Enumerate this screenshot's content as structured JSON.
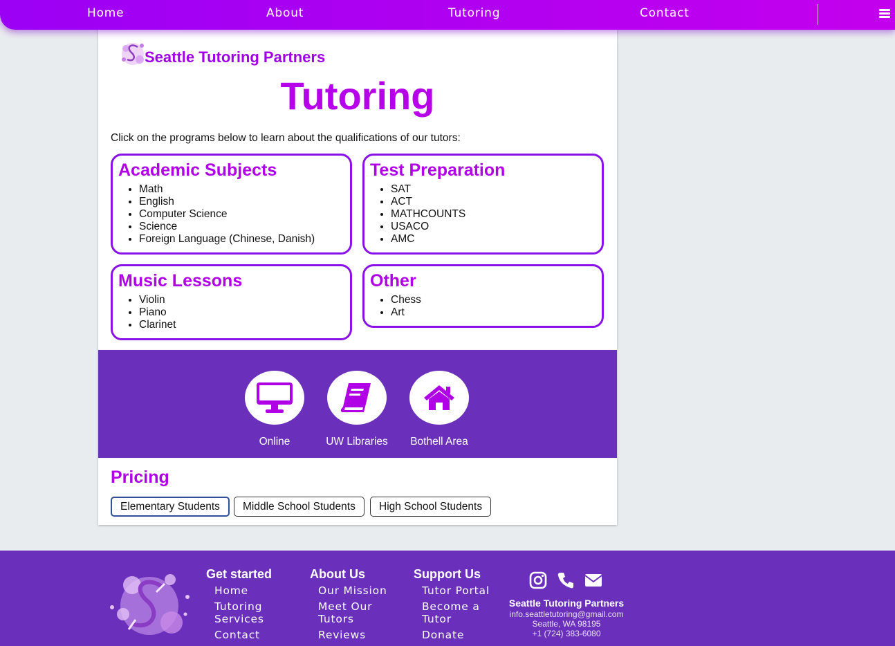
{
  "nav": {
    "links": [
      "Home",
      "About",
      "Tutoring",
      "Contact"
    ],
    "menu_icon": "hamburger-icon",
    "gradient": [
      "#9b00f5",
      "#c300ee"
    ]
  },
  "brand": {
    "name": "Seattle Tutoring Partners",
    "logo_icon": "brand-s-logo",
    "color": "#a100e6"
  },
  "page": {
    "title": "Tutoring",
    "intro": "Click on the programs below to learn about the qualifications of our tutors:"
  },
  "programs": [
    {
      "title": "Academic Subjects",
      "items": [
        "Math",
        "English",
        "Computer Science",
        "Science",
        "Foreign Language (Chinese, Danish)"
      ]
    },
    {
      "title": "Test Preparation",
      "items": [
        "SAT",
        "ACT",
        "MATHCOUNTS",
        "USACO",
        "AMC"
      ]
    },
    {
      "title": "Music Lessons",
      "items": [
        "Violin",
        "Piano",
        "Clarinet"
      ]
    },
    {
      "title": "Other",
      "items": [
        "Chess",
        "Art"
      ]
    }
  ],
  "locations": [
    {
      "label": "Online",
      "icon": "desktop-icon"
    },
    {
      "label": "UW Libraries",
      "icon": "book-icon"
    },
    {
      "label": "Bothell Area",
      "icon": "home-icon"
    }
  ],
  "pricing": {
    "title": "Pricing",
    "tabs": [
      "Elementary Students",
      "Middle School Students",
      "High School Students"
    ],
    "selected": "Elementary Students"
  },
  "footer": {
    "columns": [
      {
        "heading": "Get started",
        "links": [
          "Home",
          "Tutoring Services",
          "Contact"
        ]
      },
      {
        "heading": "About Us",
        "links": [
          "Our Mission",
          "Meet Our Tutors",
          "Reviews"
        ]
      },
      {
        "heading": "Support Us",
        "links": [
          "Tutor Portal",
          "Become a Tutor",
          "Donate"
        ]
      }
    ],
    "social_icons": [
      "instagram-icon",
      "phone-icon",
      "envelope-icon"
    ],
    "contact": {
      "name": "Seattle Tutoring Partners",
      "email": "info.seattletutoring@gmail.com",
      "address": "Seattle, WA 98195",
      "phone": "+1 (724) 383-6080"
    }
  },
  "colors": {
    "accent": "#b000e6",
    "border": "#8a12e6",
    "band": "#6b30bb",
    "background": "#e9ecef"
  }
}
